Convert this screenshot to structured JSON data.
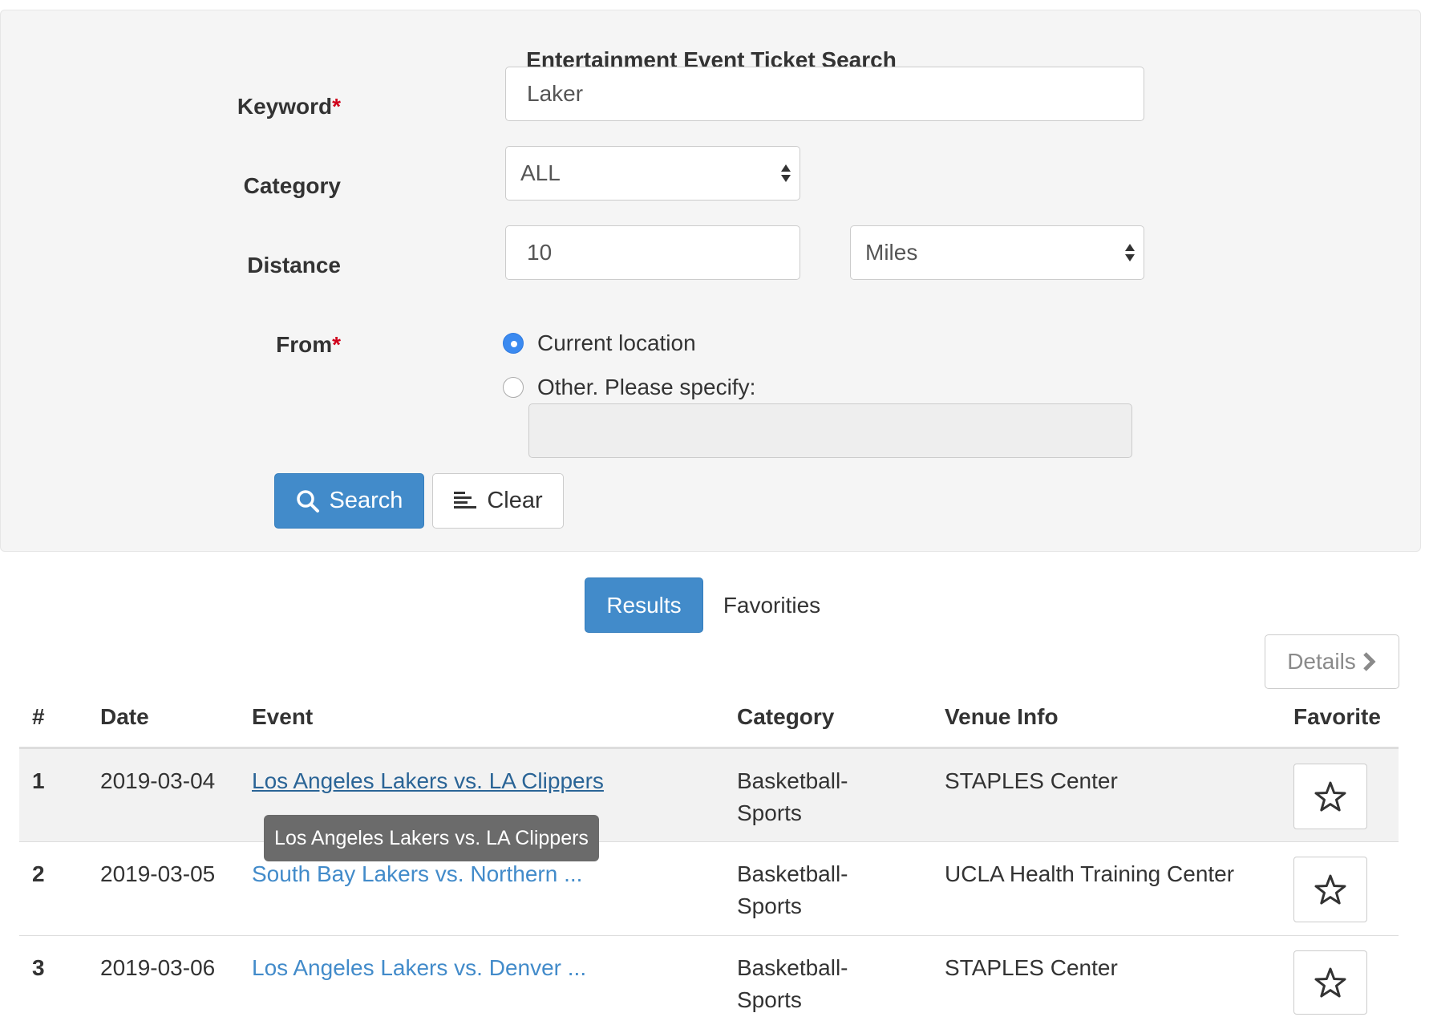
{
  "form": {
    "title": "Entertainment Event Ticket Search",
    "keyword_label": "Keyword",
    "keyword_value": "Laker",
    "category_label": "Category",
    "category_value": "ALL",
    "distance_label": "Distance",
    "distance_value": "10",
    "distance_unit": "Miles",
    "from_label": "From",
    "required_mark": "*",
    "radio_current": "Current location",
    "radio_other": "Other. Please specify:",
    "radio_selected": "current",
    "other_location_value": "",
    "search_button": "Search",
    "clear_button": "Clear"
  },
  "tabs": {
    "results": "Results",
    "favorites": "Favorities",
    "active": "results"
  },
  "details_button": "Details",
  "table": {
    "headers": [
      "#",
      "Date",
      "Event",
      "Category",
      "Venue Info",
      "Favorite"
    ],
    "rows": [
      {
        "num": "1",
        "date": "2019-03-04",
        "event": "Los Angeles Lakers vs. LA Clippers",
        "category_line1": "Basketball-",
        "category_line2": "Sports",
        "venue": "STAPLES Center"
      },
      {
        "num": "2",
        "date": "2019-03-05",
        "event": "South Bay Lakers vs. Northern ...",
        "category_line1": "Basketball-",
        "category_line2": "Sports",
        "venue": "UCLA Health Training Center"
      },
      {
        "num": "3",
        "date": "2019-03-06",
        "event": "Los Angeles Lakers vs. Denver ...",
        "category_line1": "Basketball-",
        "category_line2": "Sports",
        "venue": "STAPLES Center"
      }
    ]
  },
  "tooltip": "Los Angeles Lakers vs. LA Clippers",
  "colors": {
    "primary": "#428bca",
    "panel_bg": "#f5f5f5",
    "required": "#d0021b",
    "radio_checked": "#3b8af0"
  }
}
